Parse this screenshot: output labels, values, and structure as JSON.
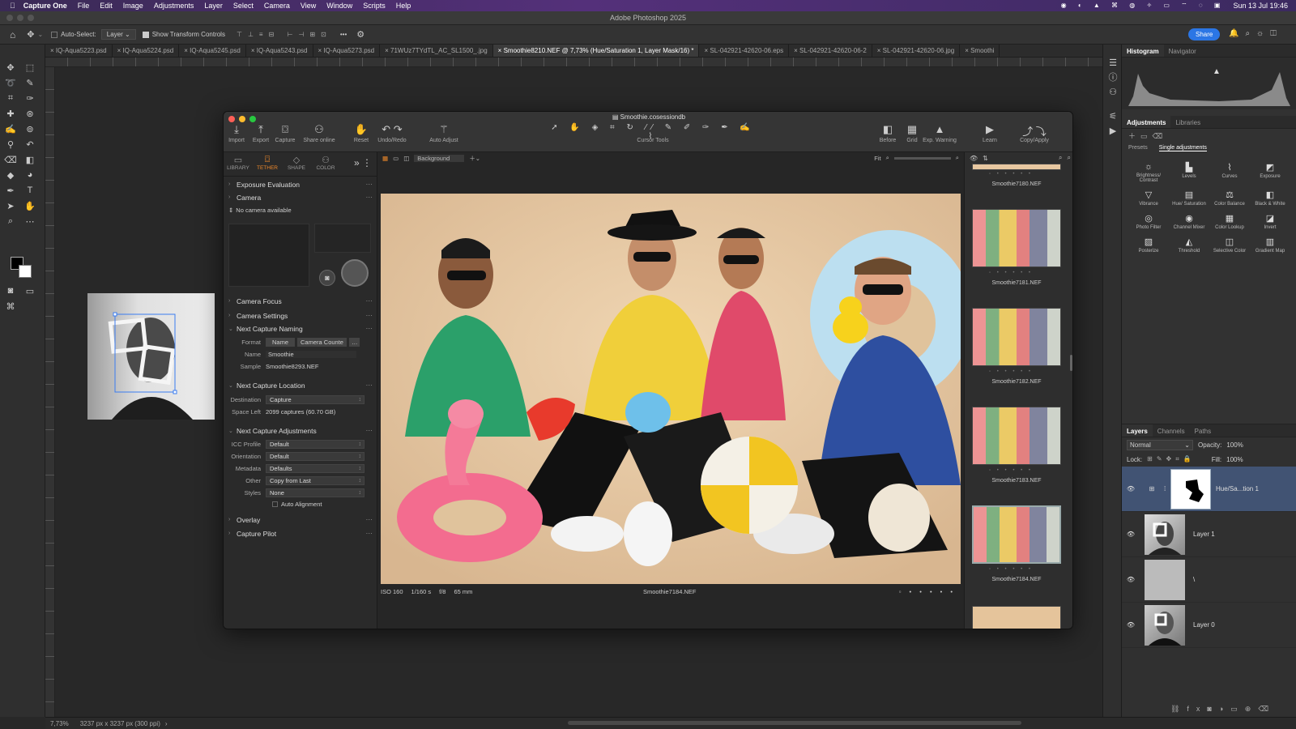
{
  "menubar": {
    "apple": "",
    "app": "Capture One",
    "items": [
      "File",
      "Edit",
      "Image",
      "Adjustments",
      "Layer",
      "Select",
      "Camera",
      "View",
      "Window",
      "Scripts",
      "Help"
    ],
    "clock": "Sun 13 Jul 19:46"
  },
  "ps": {
    "title": "Adobe Photoshop 2025",
    "options": {
      "auto_select": "Auto-Select:",
      "layer_value": "Layer",
      "show_transform": "Show Transform Controls",
      "share": "Share"
    },
    "tabs": [
      "IQ-Aqua5223.psd",
      "IQ-Aqua5224.psd",
      "IQ-Aqua5245.psd",
      "IQ-Aqua5243.psd",
      "IQ-Aqua5273.psd",
      "71WUz7TYdTL_AC_SL1500_.jpg",
      "Smoothie8210.NEF @ 7,73% (Hue/Saturation 1, Layer Mask/16) *",
      "SL-042921-42620-06.eps",
      "SL-042921-42620-06-2",
      "SL-042921-42620-06.jpg",
      "Smoothi"
    ],
    "status": {
      "zoom": "7,73%",
      "doc": "3237 px x 3237 px (300 ppi)"
    },
    "panels": {
      "top_tabs": [
        "Histogram",
        "Navigator"
      ],
      "adj_tabs": [
        "Adjustments",
        "Libraries"
      ],
      "adj_subtabs": [
        "Presets",
        "Single adjustments"
      ],
      "adjustments": [
        {
          "label": "Brightness/ Contrast",
          "icon": "☼"
        },
        {
          "label": "Levels",
          "icon": "▙"
        },
        {
          "label": "Curves",
          "icon": "⌇"
        },
        {
          "label": "Exposure",
          "icon": "◩"
        },
        {
          "label": "Vibrance",
          "icon": "▽"
        },
        {
          "label": "Hue/ Saturation",
          "icon": "▤"
        },
        {
          "label": "Color Balance",
          "icon": "⚖"
        },
        {
          "label": "Black & White",
          "icon": "◧"
        },
        {
          "label": "Photo Filter",
          "icon": "◎"
        },
        {
          "label": "Channel Mixer",
          "icon": "◉"
        },
        {
          "label": "Color Lookup",
          "icon": "▦"
        },
        {
          "label": "Invert",
          "icon": "◪"
        },
        {
          "label": "Posterize",
          "icon": "▨"
        },
        {
          "label": "Threshold",
          "icon": "◭"
        },
        {
          "label": "Selective Color",
          "icon": "◫"
        },
        {
          "label": "Gradient Map",
          "icon": "▥"
        }
      ],
      "layer_tabs": [
        "Layers",
        "Channels",
        "Paths"
      ],
      "blend": "Normal",
      "opacity_label": "Opacity:",
      "opacity": "100%",
      "lock_label": "Lock:",
      "fill_label": "Fill:",
      "fill": "100%",
      "layers": [
        {
          "name": "Hue/Sa...tion 1",
          "selected": true
        },
        {
          "name": "Layer 1",
          "selected": false
        },
        {
          "name": "\\",
          "selected": false
        },
        {
          "name": "Layer 0",
          "selected": false
        }
      ]
    }
  },
  "c1": {
    "title": "Smoothie.cosessiondb",
    "toolbar": {
      "import": "Import",
      "export": "Export",
      "capture": "Capture",
      "share": "Share online",
      "reset": "Reset",
      "undo": "Undo/Redo",
      "auto": "Auto Adjust",
      "cursor": "Cursor Tools",
      "before": "Before",
      "grid": "Grid",
      "exp": "Exp. Warning",
      "learn": "Learn",
      "copy": "Copy/Apply"
    },
    "tool_tabs": [
      "LIBRARY",
      "TETHER",
      "SHAPE",
      "COLOR"
    ],
    "sections": {
      "exposure": "Exposure Evaluation",
      "camera": "Camera",
      "no_camera": "No camera available",
      "focus": "Camera Focus",
      "settings": "Camera Settings",
      "naming": "Next Capture Naming",
      "location": "Next Capture Location",
      "adjustments": "Next Capture Adjustments",
      "overlay": "Overlay",
      "pilot": "Capture Pilot"
    },
    "naming": {
      "format_label": "Format",
      "token1": "Name",
      "token2": "Camera Counte",
      "name_label": "Name",
      "name_value": "Smoothie",
      "sample_label": "Sample",
      "sample_value": "Smoothie8293.NEF"
    },
    "location": {
      "dest_label": "Destination",
      "dest_value": "Capture",
      "space_label": "Space Left",
      "space_value": "2099 captures (60.70 GB)"
    },
    "adj": {
      "icc_label": "ICC Profile",
      "icc": "Default",
      "orient_label": "Orientation",
      "orient": "Default",
      "meta_label": "Metadata",
      "meta": "Defaults",
      "other_label": "Other",
      "other": "Copy from Last",
      "styles_label": "Styles",
      "styles": "None",
      "auto_align": "Auto Alignment"
    },
    "viewer": {
      "bg": "Background",
      "fit": "Fit",
      "iso": "ISO 160",
      "shutter": "1/160 s",
      "aperture": "f/8",
      "focal": "65 mm",
      "file": "Smoothie7184.NEF"
    },
    "thumbs": [
      "Smoothie7180.NEF",
      "Smoothie7181.NEF",
      "Smoothie7182.NEF",
      "Smoothie7183.NEF",
      "Smoothie7184.NEF"
    ]
  }
}
